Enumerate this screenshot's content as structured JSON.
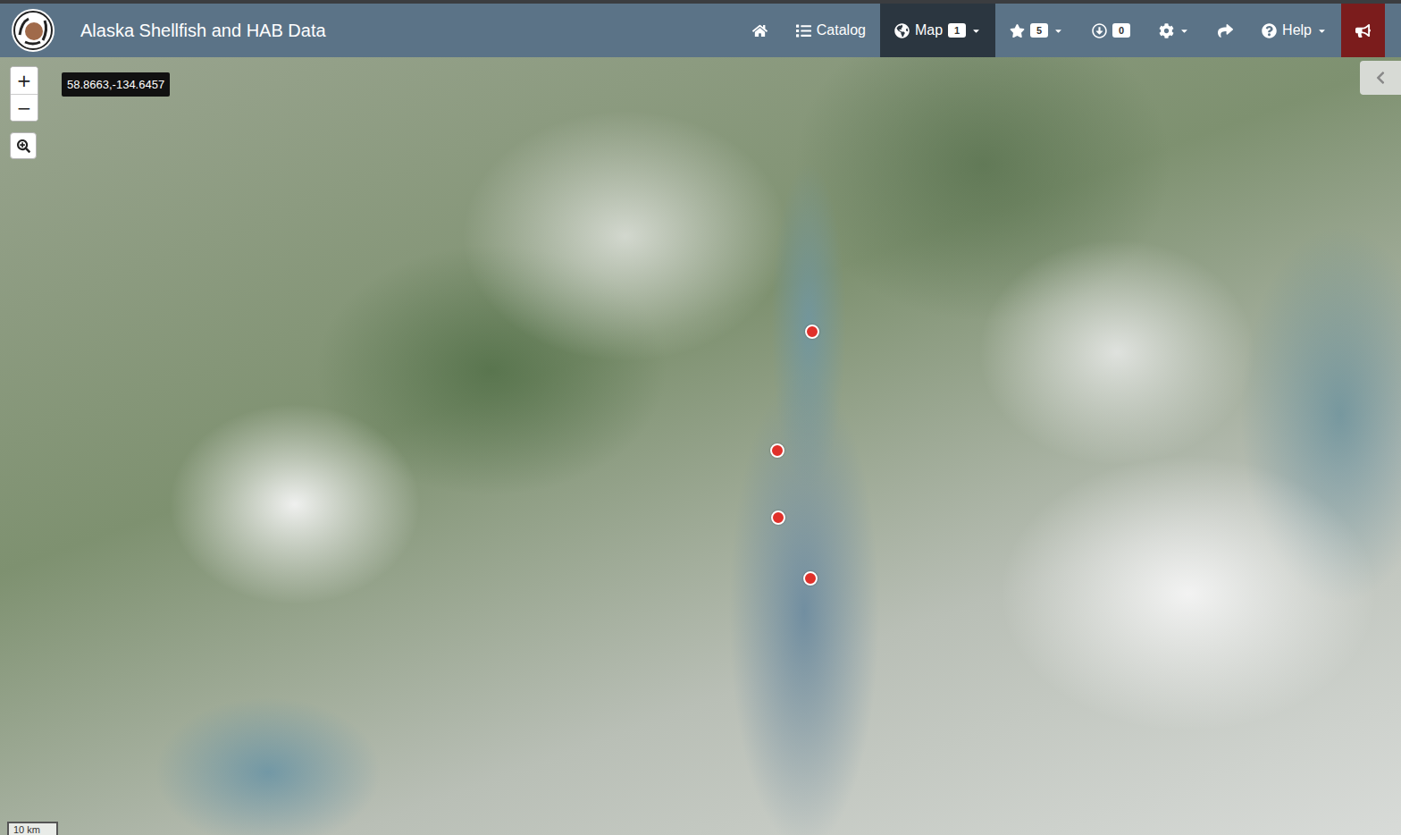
{
  "app": {
    "title": "Alaska Shellfish and HAB Data"
  },
  "nav": {
    "items": [
      {
        "label": "",
        "badge": "",
        "dropdown": false,
        "selected": false,
        "kind": "link"
      },
      {
        "label": "Catalog",
        "badge": "",
        "dropdown": false,
        "selected": false,
        "kind": "link"
      },
      {
        "label": "Map",
        "badge": "1",
        "dropdown": true,
        "selected": true,
        "kind": "link"
      },
      {
        "label": "",
        "badge": "5",
        "dropdown": true,
        "selected": false,
        "kind": "link"
      },
      {
        "label": "",
        "badge": "0",
        "dropdown": false,
        "selected": false,
        "kind": "link"
      },
      {
        "label": "",
        "badge": "",
        "dropdown": true,
        "selected": false,
        "kind": "link"
      },
      {
        "label": "",
        "badge": "",
        "dropdown": false,
        "selected": false,
        "kind": "link"
      },
      {
        "label": "Help",
        "badge": "",
        "dropdown": true,
        "selected": false,
        "kind": "link"
      },
      {
        "label": "",
        "badge": "",
        "dropdown": false,
        "selected": false,
        "kind": "alert"
      }
    ]
  },
  "map": {
    "zoom_in": "+",
    "zoom_out": "−",
    "coordinates": "58.8663,-134.6457",
    "scale": "10 km",
    "markers": [
      {
        "color": "#e0302a"
      },
      {
        "color": "#e0302a"
      },
      {
        "color": "#e0302a"
      },
      {
        "color": "#e0302a"
      }
    ]
  }
}
